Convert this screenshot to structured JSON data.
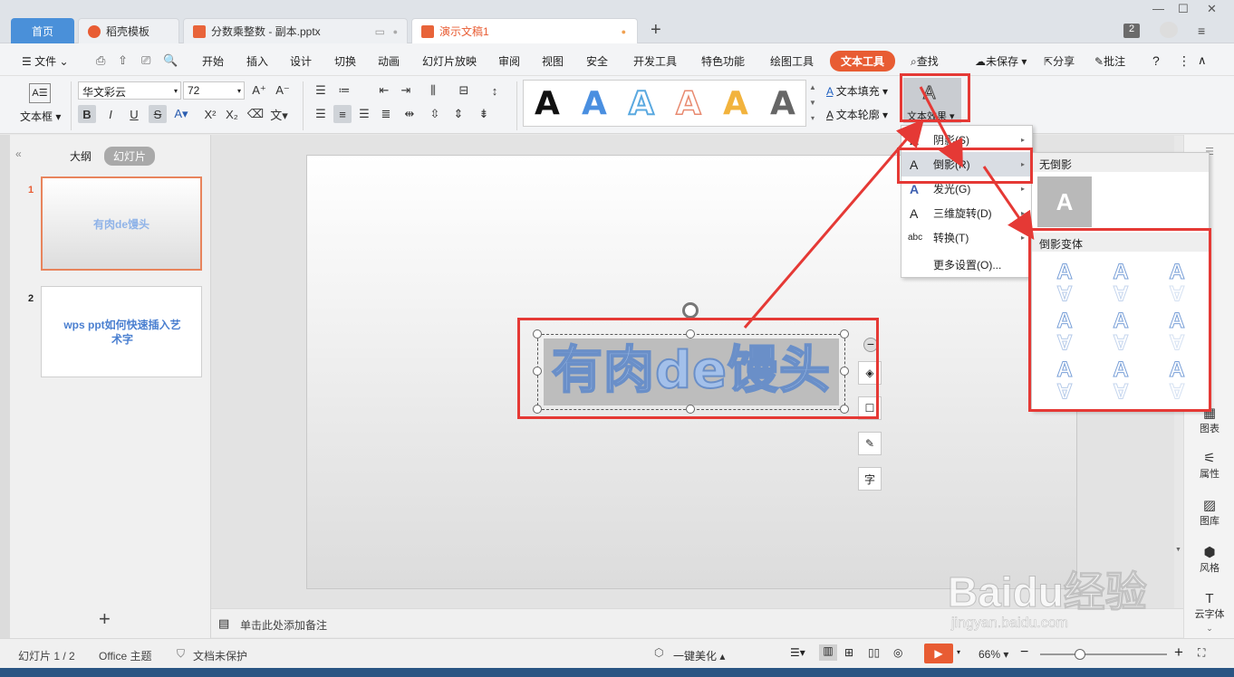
{
  "tabs": [
    {
      "label": "首页"
    },
    {
      "label": "稻壳模板"
    },
    {
      "label": "分数乘整数 - 副本.pptx"
    },
    {
      "label": "演示文稿1"
    }
  ],
  "tab_count_badge": "2",
  "menus": [
    "文件",
    "开始",
    "插入",
    "设计",
    "切换",
    "动画",
    "幻灯片放映",
    "审阅",
    "视图",
    "安全",
    "开发工具",
    "特色功能",
    "绘图工具",
    "文本工具"
  ],
  "menu_right": {
    "search": "查找",
    "unsaved": "未保存",
    "share": "分享",
    "annotate": "批注"
  },
  "ribbon": {
    "textbox_label": "文本框",
    "font_name": "华文彩云",
    "font_size": "72",
    "text_fill": "文本填充",
    "text_outline": "文本轮廓",
    "text_effect": "文本效果"
  },
  "style_gallery": [
    "A",
    "A",
    "A",
    "A",
    "A",
    "A"
  ],
  "left_panel": {
    "tab_outline": "大纲",
    "tab_slides": "幻灯片",
    "slides": [
      {
        "num": "1",
        "text": "有肉de馒头"
      },
      {
        "num": "2",
        "text": "wps ppt如何快速插入艺术字"
      }
    ]
  },
  "slide_text": "有肉de馒头",
  "effect_menu": [
    {
      "label": "阴影(S)",
      "icon": "shadow-icon",
      "arrow": true
    },
    {
      "label": "倒影(R)",
      "icon": "reflection-icon",
      "arrow": true,
      "active": true
    },
    {
      "label": "发光(G)",
      "icon": "glow-icon",
      "arrow": true
    },
    {
      "label": "三维旋转(D)",
      "icon": "3d-rotate-icon",
      "arrow": true
    },
    {
      "label": "转换(T)",
      "icon": "transform-icon",
      "arrow": true
    },
    {
      "label": "更多设置(O)...",
      "icon": "",
      "arrow": false
    }
  ],
  "reflection_menu": {
    "no_reflection_header": "无倒影",
    "variants_header": "倒影变体",
    "sample_glyph": "A"
  },
  "notes_placeholder": "单击此处添加备注",
  "status": {
    "slide_counter": "幻灯片 1 / 2",
    "theme": "Office 主题",
    "protect": "文档未保护",
    "beautify": "一键美化",
    "zoom": "66%"
  },
  "right_sidebar": [
    "图表",
    "属性",
    "图库",
    "风格",
    "云字体"
  ],
  "watermark": {
    "brand": "Baidu经验",
    "url": "jingyan.baidu.com"
  },
  "colors": {
    "accent": "#e85c33",
    "home_tab": "#4a90d9",
    "annotation": "#e53935",
    "art_text": "#8fb3e8"
  }
}
